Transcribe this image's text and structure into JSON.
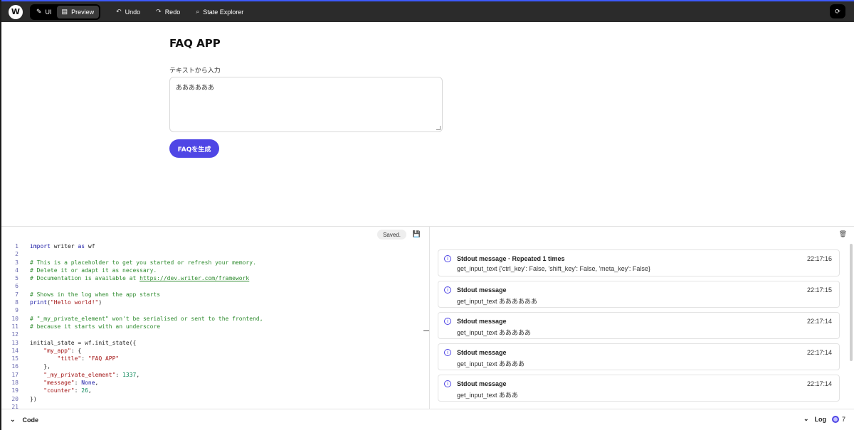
{
  "topbar": {
    "logo": "W",
    "modes": [
      {
        "label": "UI",
        "icon": "pencil-icon"
      },
      {
        "label": "Preview",
        "icon": "grid-icon"
      }
    ],
    "undo": "Undo",
    "redo": "Redo",
    "state_explorer": "State Explorer"
  },
  "app": {
    "title": "FAQ APP",
    "input_label": "テキストから入力",
    "input_value": "ああああああ",
    "button_label": "FAQを生成"
  },
  "code_panel": {
    "saved": "Saved.",
    "lines": [
      {
        "n": "1",
        "html": "<span class='kw'>import</span> writer <span class='kw'>as</span> wf"
      },
      {
        "n": "2",
        "html": ""
      },
      {
        "n": "3",
        "html": "<span class='cm'># This is a placeholder to get you started or refresh your memory.</span>"
      },
      {
        "n": "4",
        "html": "<span class='cm'># Delete it or adapt it as necessary.</span>"
      },
      {
        "n": "5",
        "html": "<span class='cm'># Documentation is available at </span><span class='ur'>https://dev.writer.com/framework</span>"
      },
      {
        "n": "6",
        "html": ""
      },
      {
        "n": "7",
        "html": "<span class='cm'># Shows in the log when the app starts</span>"
      },
      {
        "n": "8",
        "html": "<span class='kw'>print</span>(<span class='st'>\"Hello world!\"</span>)"
      },
      {
        "n": "9",
        "html": ""
      },
      {
        "n": "10",
        "html": "<span class='cm'># \"_my_private_element\" won't be serialised or sent to the frontend,</span>"
      },
      {
        "n": "11",
        "html": "<span class='cm'># because it starts with an underscore</span>"
      },
      {
        "n": "12",
        "html": ""
      },
      {
        "n": "13",
        "html": "initial_state = wf.init_state({"
      },
      {
        "n": "14",
        "html": "    <span class='st'>\"my_app\"</span>: {"
      },
      {
        "n": "15",
        "html": "        <span class='st'>\"title\"</span>: <span class='st'>\"FAQ APP\"</span>"
      },
      {
        "n": "16",
        "html": "    },"
      },
      {
        "n": "17",
        "html": "    <span class='st'>\"_my_private_element\"</span>: <span class='nu'>1337</span>,"
      },
      {
        "n": "18",
        "html": "    <span class='st'>\"message\"</span>: <span class='kw'>None</span>,"
      },
      {
        "n": "19",
        "html": "    <span class='st'>\"counter\"</span>: <span class='nu'>26</span>,"
      },
      {
        "n": "20",
        "html": "})"
      },
      {
        "n": "21",
        "html": ""
      }
    ]
  },
  "log_panel": {
    "entries": [
      {
        "title": "Stdout message · Repeated 1 times",
        "time": "22:17:16",
        "message": "get_input_text {'ctrl_key': False, 'shift_key': False, 'meta_key': False}"
      },
      {
        "title": "Stdout message",
        "time": "22:17:15",
        "message": "get_input_text ああああああ"
      },
      {
        "title": "Stdout message",
        "time": "22:17:14",
        "message": "get_input_text あああああ"
      },
      {
        "title": "Stdout message",
        "time": "22:17:14",
        "message": "get_input_text ああああ"
      },
      {
        "title": "Stdout message",
        "time": "22:17:14",
        "message": "get_input_text あああ"
      }
    ]
  },
  "statusbar": {
    "code_label": "Code",
    "log_label": "Log",
    "log_count": "7"
  }
}
